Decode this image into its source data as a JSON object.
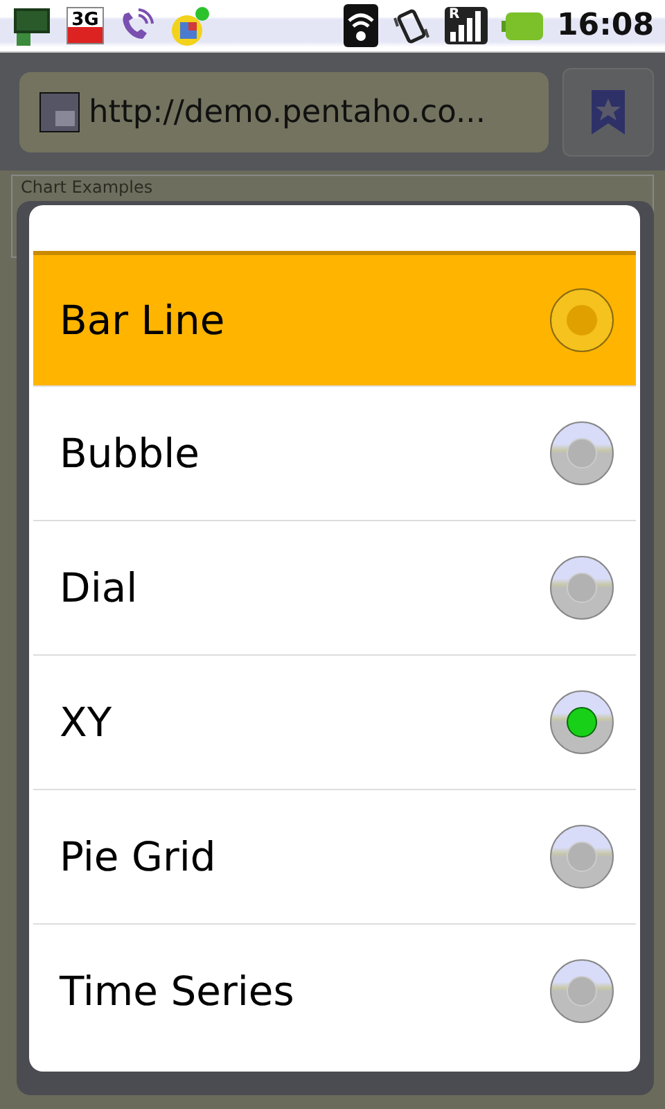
{
  "status_bar": {
    "network_badge": "3G",
    "roaming_badge": "R",
    "time": "16:08"
  },
  "browser": {
    "url": "http://demo.pentaho.co..."
  },
  "page": {
    "heading": "Chart Examples"
  },
  "dialog": {
    "options": [
      {
        "label": "Bar Line",
        "selected": false,
        "highlighted": true
      },
      {
        "label": "Bubble",
        "selected": false,
        "highlighted": false
      },
      {
        "label": "Dial",
        "selected": false,
        "highlighted": false
      },
      {
        "label": "XY",
        "selected": true,
        "highlighted": false
      },
      {
        "label": "Pie Grid",
        "selected": false,
        "highlighted": false
      },
      {
        "label": "Time Series",
        "selected": false,
        "highlighted": false
      }
    ]
  }
}
